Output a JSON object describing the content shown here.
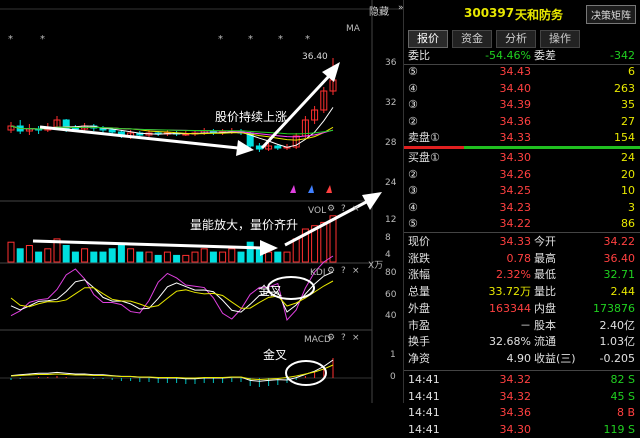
{
  "chart": {
    "hide_label": "隐藏",
    "ma_label": "MA",
    "price_peak": "36.40",
    "price_axis": [
      "36",
      "32",
      "28",
      "24"
    ],
    "vol_label": "VOL",
    "vol_axis": [
      "12",
      "8",
      "4"
    ],
    "vol_unit": "X万",
    "kdj_label": "KDJ",
    "kdj_axis": [
      "80",
      "60",
      "40"
    ],
    "macd_label": "MACD",
    "macd_axis": [
      "1",
      "0"
    ],
    "annotations": {
      "price_trend": "股价持续上涨",
      "vol_trend": "量能放大，量价齐升",
      "kdj_cross": "金叉",
      "macd_cross": "金叉"
    }
  },
  "header": {
    "code": "300397",
    "name": "天和防务",
    "button": "决策矩阵"
  },
  "tabs": [
    "报价",
    "资金",
    "分析",
    "操作"
  ],
  "active_tab": "报价",
  "weibi": {
    "label": "委比",
    "value": "-54.46%",
    "label2": "委差",
    "value2": "-342"
  },
  "sell_orders": [
    {
      "label": "⑤",
      "price": "34.43",
      "vol": "6"
    },
    {
      "label": "④",
      "price": "34.40",
      "vol": "263"
    },
    {
      "label": "③",
      "price": "34.39",
      "vol": "35"
    },
    {
      "label": "②",
      "price": "34.36",
      "vol": "27"
    },
    {
      "label": "卖盘①",
      "price": "34.33",
      "vol": "154"
    }
  ],
  "buy_orders": [
    {
      "label": "买盘①",
      "price": "34.30",
      "vol": "24"
    },
    {
      "label": "②",
      "price": "34.26",
      "vol": "20"
    },
    {
      "label": "③",
      "price": "34.25",
      "vol": "10"
    },
    {
      "label": "④",
      "price": "34.23",
      "vol": "3"
    },
    {
      "label": "⑤",
      "price": "34.22",
      "vol": "86"
    }
  ],
  "stats": [
    {
      "l1": "现价",
      "v1": "34.33",
      "l2": "今开",
      "v2": "34.22"
    },
    {
      "l1": "涨跌",
      "v1": "0.78",
      "l2": "最高",
      "v2": "36.40"
    },
    {
      "l1": "涨幅",
      "v1": "2.32%",
      "l2": "最低",
      "v2": "32.71"
    },
    {
      "l1": "总量",
      "v1": "33.72万",
      "l2": "量比",
      "v2": "2.44"
    },
    {
      "l1": "外盘",
      "v1": "163344",
      "l2": "内盘",
      "v2": "173876"
    },
    {
      "l1": "市盈",
      "v1": "－",
      "l2": "股本",
      "v2": "2.40亿"
    },
    {
      "l1": "换手",
      "v1": "32.68%",
      "l2": "流通",
      "v2": "1.03亿"
    },
    {
      "l1": "净资",
      "v1": "4.90",
      "l2": "收益(三)",
      "v2": "-0.205"
    }
  ],
  "ticks": [
    {
      "time": "14:41",
      "price": "34.32",
      "vol": "82",
      "dir": "S"
    },
    {
      "time": "14:41",
      "price": "34.32",
      "vol": "45",
      "dir": "S"
    },
    {
      "time": "14:41",
      "price": "34.36",
      "vol": "8",
      "dir": "B"
    },
    {
      "time": "14:41",
      "price": "34.30",
      "vol": "119",
      "dir": "S"
    }
  ]
}
